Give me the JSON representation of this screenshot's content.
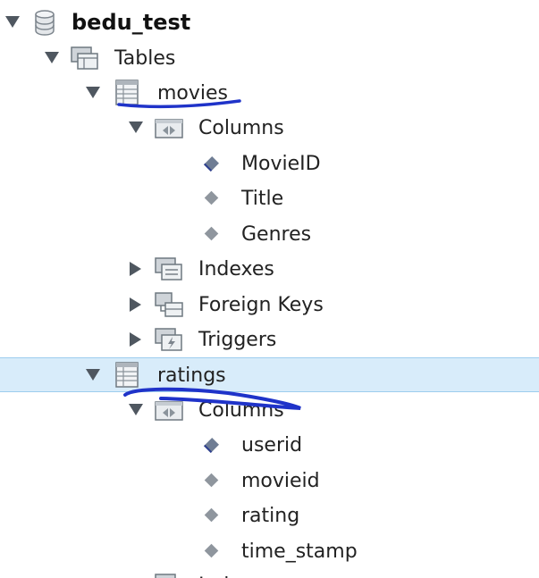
{
  "tree": {
    "schema": {
      "label": "bedu_test",
      "icon": "database-icon"
    },
    "tables_group": {
      "label": "Tables",
      "icon": "tables-folder-icon"
    },
    "movies": {
      "label": "movies",
      "icon": "table-icon",
      "columns_group": {
        "label": "Columns",
        "icon": "columns-folder-icon"
      },
      "columns": [
        "MovieID",
        "Title",
        "Genres"
      ],
      "indexes": {
        "label": "Indexes",
        "icon": "indexes-folder-icon"
      },
      "foreign_keys": {
        "label": "Foreign Keys",
        "icon": "foreign-keys-folder-icon"
      },
      "triggers": {
        "label": "Triggers",
        "icon": "triggers-folder-icon"
      }
    },
    "ratings": {
      "label": "ratings",
      "icon": "table-icon",
      "selected": true,
      "columns_group": {
        "label": "Columns",
        "icon": "columns-folder-icon"
      },
      "columns": [
        "userid",
        "movieid",
        "rating",
        "time_stamp"
      ],
      "next_group": {
        "label": "Indexes",
        "icon": "indexes-folder-icon"
      }
    }
  },
  "colors": {
    "selection_bg": "#d8ecfa",
    "selection_border": "#9dcdee",
    "annotation_ink": "#1f33c9"
  }
}
